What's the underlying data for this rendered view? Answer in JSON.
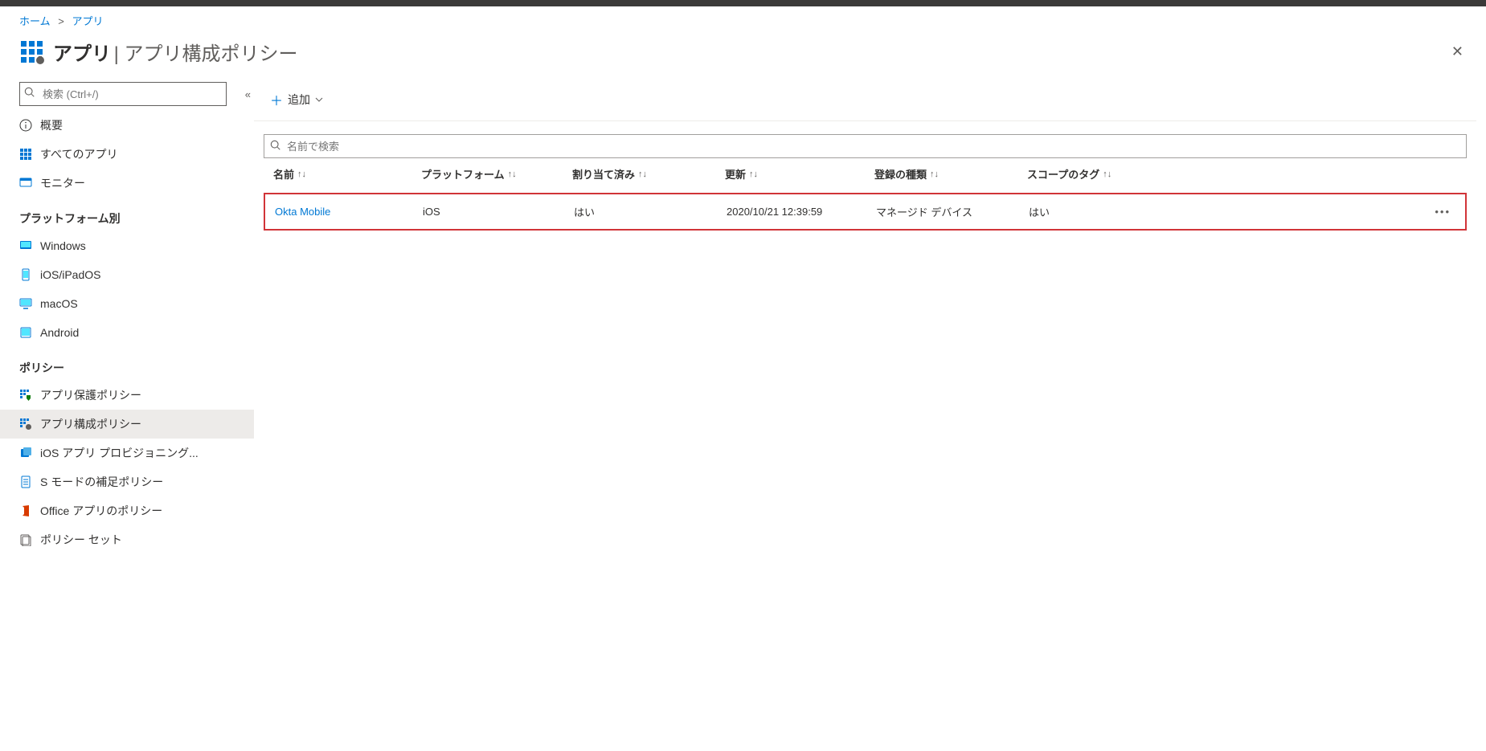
{
  "breadcrumb": {
    "home": "ホーム",
    "app": "アプリ"
  },
  "header": {
    "title": "アプリ",
    "subtitle": "アプリ構成ポリシー"
  },
  "sidebar": {
    "search_placeholder": "検索 (Ctrl+/)",
    "items_top": [
      {
        "label": "概要"
      },
      {
        "label": "すべてのアプリ"
      },
      {
        "label": "モニター"
      }
    ],
    "group_platform": "プラットフォーム別",
    "platforms": [
      {
        "label": "Windows"
      },
      {
        "label": "iOS/iPadOS"
      },
      {
        "label": "macOS"
      },
      {
        "label": "Android"
      }
    ],
    "group_policy": "ポリシー",
    "policies": [
      {
        "label": "アプリ保護ポリシー"
      },
      {
        "label": "アプリ構成ポリシー"
      },
      {
        "label": "iOS アプリ プロビジョニング..."
      },
      {
        "label": "S モードの補足ポリシー"
      },
      {
        "label": "Office アプリのポリシー"
      },
      {
        "label": "ポリシー セット"
      }
    ]
  },
  "toolbar": {
    "add": "追加"
  },
  "main": {
    "search_placeholder": "名前で検索",
    "columns": {
      "name": "名前",
      "platform": "プラットフォーム",
      "assigned": "割り当て済み",
      "updated": "更新",
      "type": "登録の種類",
      "tag": "スコープのタグ"
    },
    "row": {
      "name": "Okta Mobile",
      "platform": "iOS",
      "assigned": "はい",
      "updated": "2020/10/21 12:39:59",
      "type": "マネージド デバイス",
      "tag": "はい"
    }
  }
}
